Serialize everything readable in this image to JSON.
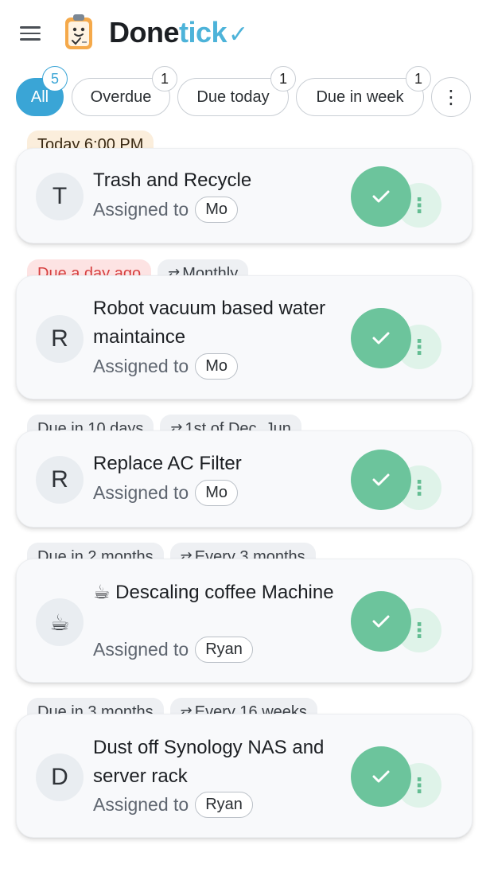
{
  "app": {
    "brand_dark": "Done",
    "brand_light": "tick",
    "brand_check": "✓"
  },
  "filters": [
    {
      "label": "All",
      "count": "5",
      "active": true
    },
    {
      "label": "Overdue",
      "count": "1"
    },
    {
      "label": "Due today",
      "count": "1"
    },
    {
      "label": "Due in week",
      "count": "1"
    },
    {
      "label": "⋮"
    }
  ],
  "tasks": [
    {
      "due": "Today 6:00 PM",
      "avatar": "T",
      "title": "Trash and Recycle",
      "assigned_label": "Assigned to",
      "assignee": "Mo"
    },
    {
      "due": "Due a day ago",
      "repeat": "Monthly",
      "avatar": "R",
      "title": "Robot vacuum based water maintaince",
      "assigned_label": "Assigned to",
      "assignee": "Mo"
    },
    {
      "due": "Due in 10 days",
      "repeat": "1st of Dec, Jun",
      "avatar": "R",
      "title": "Replace AC Filter",
      "assigned_label": "Assigned to",
      "assignee": "Mo"
    },
    {
      "due": "Due in 2 months",
      "repeat": "Every 3 months",
      "avatar": "☕",
      "title": "☕ Descaling coffee Machine",
      "assigned_label": "Assigned to",
      "assignee": "Ryan"
    },
    {
      "due": "Due in 3 months",
      "repeat": "Every 16 weeks",
      "avatar": "D",
      "title": "Dust off Synology NAS and server rack",
      "assigned_label": "Assigned to",
      "assignee": "Ryan"
    }
  ],
  "icons": {
    "repeat": "⇄",
    "check": "check-icon",
    "more": "⋮"
  },
  "colors": {
    "accent": "#3aa5d6",
    "brand_light": "#4db3d9",
    "complete": "#6cc49c",
    "complete_soft": "#dff3e9",
    "overdue": "#d64040"
  }
}
